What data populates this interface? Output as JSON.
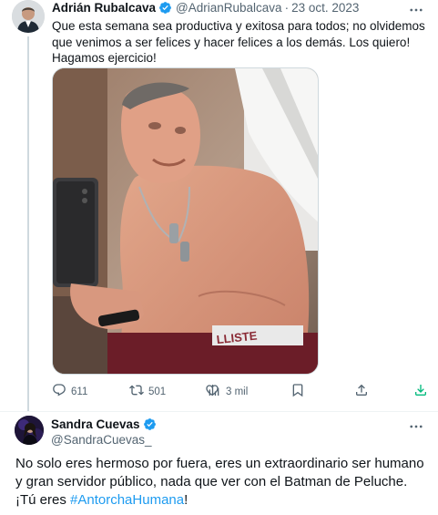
{
  "tweet": {
    "author_name": "Adrián Rubalcava",
    "handle": "@AdrianRubalcava",
    "separator": "·",
    "date": "23 oct. 2023",
    "text": "Que esta semana sea productiva y exitosa para todos; no olvidemos que venimos a ser felices y hacer felices a los demás. Los quiero! Hagamos ejercicio!",
    "actions": {
      "replies": "611",
      "retweets": "501",
      "views": "3 mil"
    }
  },
  "reply": {
    "author_name": "Sandra Cuevas",
    "handle": "@SandraCuevas_",
    "text": "No solo eres hermoso por fuera, eres un extraordinario ser humano y gran servidor público, nada que ver con el Batman de Peluche. ¡Tú eres ",
    "hashtag": "#AntorchaHumana",
    "text_end": "!"
  },
  "icons": {
    "verified": "verified-badge-icon",
    "more": "more-icon",
    "reply": "reply-icon",
    "retweet": "retweet-icon",
    "views": "views-icon",
    "bookmark": "bookmark-icon",
    "share": "share-icon",
    "download": "download-icon"
  },
  "colors": {
    "verified_blue": "#1d9bf0",
    "link": "#1d9bf0",
    "secondary_text": "#536471",
    "download_green": "#00ba7c"
  }
}
